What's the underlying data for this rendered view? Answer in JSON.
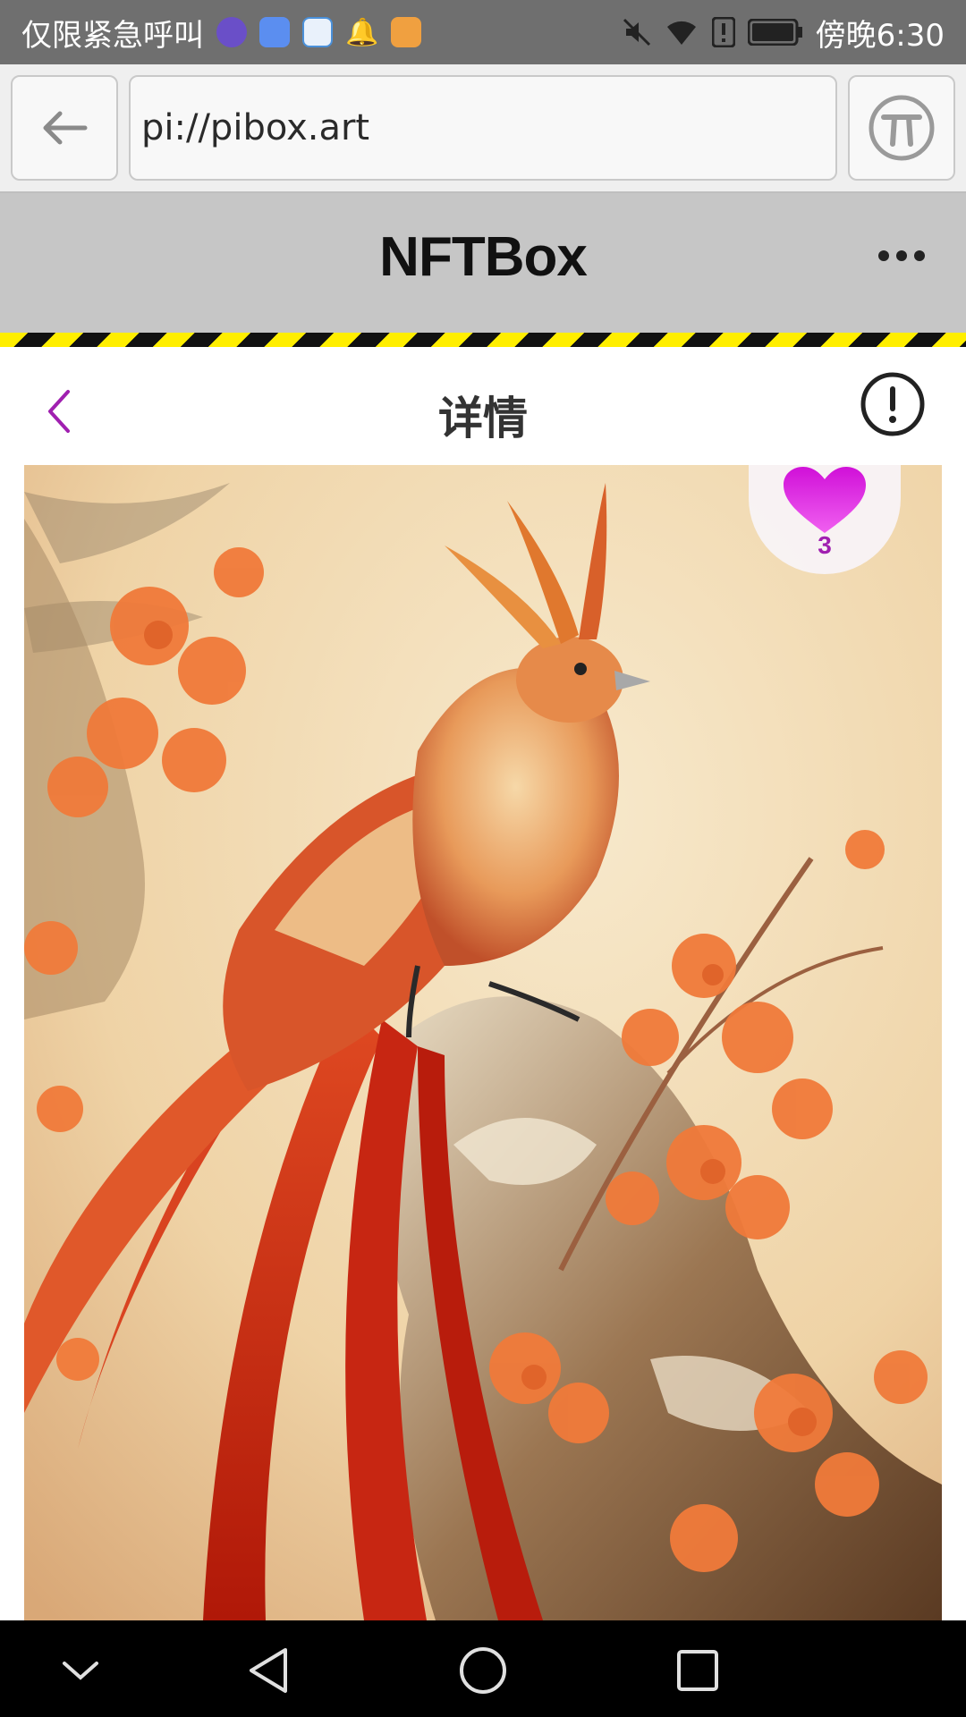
{
  "status_bar": {
    "carrier_text": "仅限紧急呼叫",
    "time_text": "傍晚6:30",
    "icons": [
      "app-icon-purple",
      "app-icon-music",
      "app-icon-blue",
      "bell-icon",
      "app-icon-orange",
      "mute-icon",
      "wifi-icon",
      "alert-icon",
      "battery-icon"
    ]
  },
  "browser": {
    "url": "pi://pibox.art",
    "back_icon": "arrow-left-icon",
    "pi_icon": "pi-logo-icon"
  },
  "app_header": {
    "title": "NFTBox",
    "menu_icon": "more-dots-icon"
  },
  "detail": {
    "title": "详情",
    "back_icon": "chevron-left-icon",
    "info_icon": "exclamation-circle-icon"
  },
  "artwork": {
    "likes": "3",
    "like_icon": "heart-icon"
  },
  "nav_bar": {
    "icons": [
      "chevron-down-icon",
      "back-triangle-icon",
      "home-circle-icon",
      "recents-square-icon"
    ]
  },
  "colors": {
    "accent": "#a020b0",
    "heart": "#d010d8",
    "status_bar": "#6f6f6f",
    "header": "#c6c6c6"
  }
}
